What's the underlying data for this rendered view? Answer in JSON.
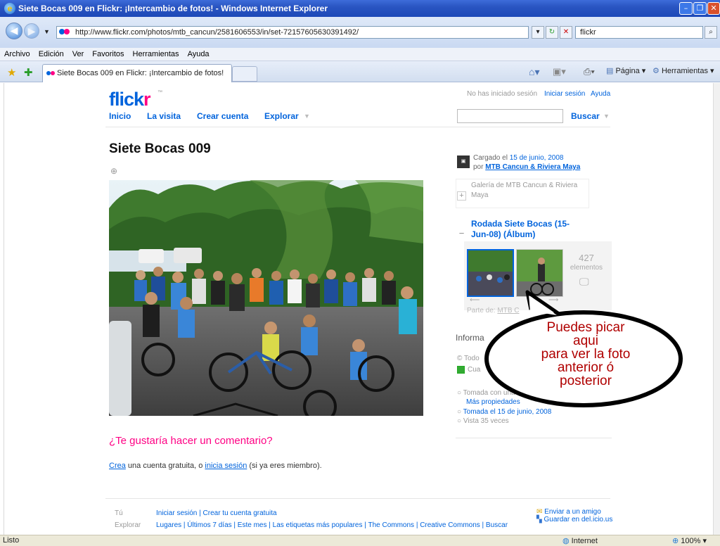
{
  "window": {
    "title": "Siete Bocas 009 en Flickr: ¡Intercambio de fotos! - Windows Internet Explorer",
    "address": "http://www.flickr.com/photos/mtb_cancun/2581606553/in/set-72157605630391492/",
    "search_value": "flickr",
    "menu": [
      "Archivo",
      "Edición",
      "Ver",
      "Favoritos",
      "Herramientas",
      "Ayuda"
    ],
    "tab_title": "Siete Bocas 009 en Flickr: ¡Intercambio de fotos!",
    "cmd_page": "Página",
    "cmd_tools": "Herramientas",
    "status_left": "Listo",
    "status_zone": "Internet",
    "status_zoom": "100%"
  },
  "flickr": {
    "logo": "flickr",
    "nav": [
      "Inicio",
      "La visita",
      "Crear cuenta",
      "Explorar"
    ],
    "not_signed": "No has iniciado sesión",
    "signin": "Iniciar sesión",
    "help": "Ayuda",
    "search_btn": "Buscar"
  },
  "photo": {
    "title": "Siete Bocas 009"
  },
  "sidebar": {
    "uploaded_prefix": "Cargado el",
    "uploaded_date": "15 de junio, 2008",
    "by_prefix": "por",
    "owner": "MTB Cancun & Riviera Maya",
    "gallery_line1": "Galería de MTB Cancun & Riviera",
    "gallery_line2": "Maya",
    "album_line1": "Rodada Siete Bocas (15-",
    "album_line2": "Jun-08) (Álbum)",
    "count_number": "427",
    "count_label": "elementos",
    "part_of": "Parte de:",
    "part_of_link": "MTB C",
    "info_heading": "Informa",
    "rights1": "Todo",
    "rights2": "Cua",
    "taken_with": "Tomada con una",
    "more_props": "Más propiedades",
    "taken_on": "Tomada el 15 de junio, 2008",
    "views": "Vista 35 veces"
  },
  "callout": {
    "line1": "Puedes picar",
    "line2": "aqui",
    "line3": "para ver la foto",
    "line4": "anterior ó",
    "line5": "posterior"
  },
  "comments": {
    "heading": "¿Te gustaría hacer un comentario?",
    "create": "Crea",
    "mid": "una cuenta gratuita, o",
    "login": "inicia sesión",
    "end": "(si ya eres miembro)."
  },
  "footer": {
    "tu_label": "Tú",
    "tu_links": "Iniciar sesión | Crear tu cuenta gratuita",
    "explorar_label": "Explorar",
    "explorar_links": "Lugares | Últimos 7 días | Este mes | Las etiquetas más populares | The Commons | Creative Commons | Buscar",
    "send_friend": "Enviar a un amigo",
    "save_delicious": "Guardar en del.icio.us"
  },
  "colors": {
    "flickr_blue": "#0063dc",
    "flickr_pink": "#ff0084",
    "callout_red": "#b00000"
  }
}
